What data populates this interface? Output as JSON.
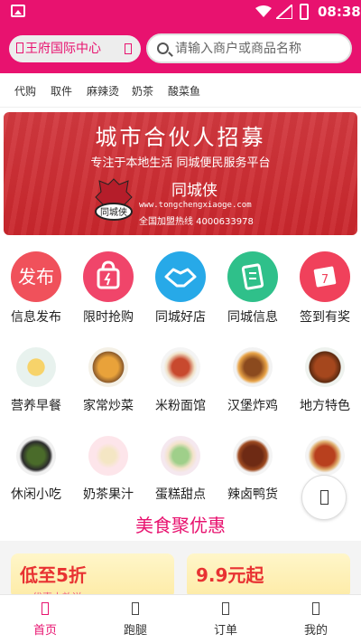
{
  "status_bar": {
    "time": "08:38",
    "icons": [
      "image-icon",
      "wifi-icon",
      "signal-icon",
      "battery-icon"
    ]
  },
  "header": {
    "location": "王府国际中心",
    "search_placeholder": "请输入商户或商品名称",
    "brand_color": "#e8126f"
  },
  "hot_tags": [
    "代购",
    "取件",
    "麻辣烫",
    "奶茶",
    "酸菜鱼"
  ],
  "banner": {
    "title": "城市合伙人招募",
    "subtitle": "专注于本地生活  同城便民服务平台",
    "brand": "同城侠",
    "url": "www.tongchengxiaoge.com",
    "hotline": "全国加盟热线  4000633978",
    "logo_text": "同城侠"
  },
  "services": [
    {
      "label": "信息发布",
      "icon": "publish-icon",
      "icon_text": "发布",
      "color": "#f0515b"
    },
    {
      "label": "限时抢购",
      "icon": "shopping-bag-icon",
      "color": "#f0456a"
    },
    {
      "label": "同城好店",
      "icon": "handshake-icon",
      "color": "#27a9e8"
    },
    {
      "label": "同城信息",
      "icon": "info-icon",
      "color": "#2fc08a"
    },
    {
      "label": "签到有奖",
      "icon": "calendar-icon",
      "color": "#f0415b"
    }
  ],
  "categories_row1": [
    {
      "label": "营养早餐",
      "icon": "breakfast-icon"
    },
    {
      "label": "家常炒菜",
      "icon": "stir-fry-icon"
    },
    {
      "label": "米粉面馆",
      "icon": "noodles-icon"
    },
    {
      "label": "汉堡炸鸡",
      "icon": "burger-icon"
    },
    {
      "label": "地方特色",
      "icon": "local-dish-icon"
    }
  ],
  "categories_row2": [
    {
      "label": "休闲小吃",
      "icon": "snack-icon"
    },
    {
      "label": "奶茶果汁",
      "icon": "milk-tea-icon"
    },
    {
      "label": "蛋糕甜点",
      "icon": "cake-icon"
    },
    {
      "label": "辣卤鸭货",
      "icon": "braised-duck-icon"
    }
  ],
  "section_title": "美食聚优惠",
  "promos": [
    {
      "title": "低至5折",
      "subtitle": "优惠大放送"
    },
    {
      "title": "9.9元起",
      "subtitle": ""
    }
  ],
  "bottom_nav": [
    {
      "label": "首页",
      "icon": "home-icon",
      "active": true
    },
    {
      "label": "跑腿",
      "icon": "errand-icon",
      "active": false
    },
    {
      "label": "订单",
      "icon": "order-icon",
      "active": false
    },
    {
      "label": "我的",
      "icon": "profile-icon",
      "active": false
    }
  ]
}
